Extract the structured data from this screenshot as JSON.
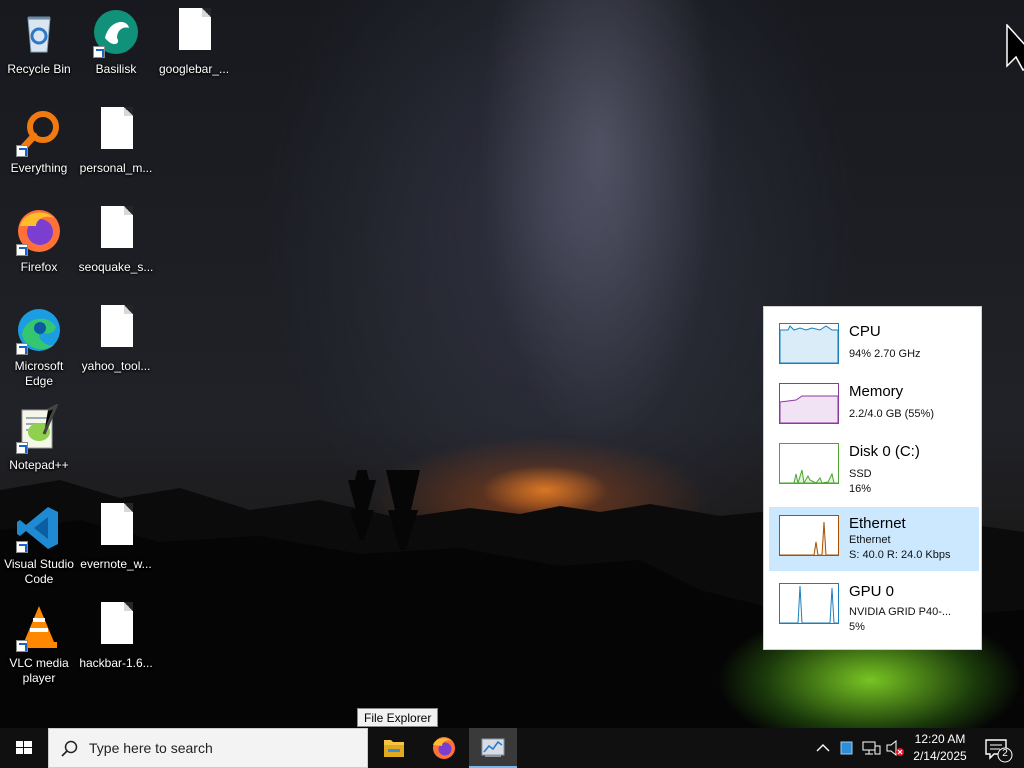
{
  "desktop": {
    "icons": [
      {
        "label": "Recycle Bin",
        "icon": "recycle-bin-icon"
      },
      {
        "label": "Basilisk",
        "icon": "basilisk-icon"
      },
      {
        "label": "googlebar_...",
        "icon": "file-icon"
      },
      {
        "label": "Everything",
        "icon": "everything-search-icon"
      },
      {
        "label": "personal_m...",
        "icon": "file-icon"
      },
      {
        "label": "Firefox",
        "icon": "firefox-icon"
      },
      {
        "label": "seoquake_s...",
        "icon": "file-icon"
      },
      {
        "label": "Microsoft Edge",
        "icon": "edge-icon"
      },
      {
        "label": "yahoo_tool...",
        "icon": "file-icon"
      },
      {
        "label": "Notepad++",
        "icon": "notepad-plus-plus-icon"
      },
      {
        "label": "Visual Studio Code",
        "icon": "vscode-icon"
      },
      {
        "label": "evernote_w...",
        "icon": "file-icon"
      },
      {
        "label": "VLC media player",
        "icon": "vlc-icon"
      },
      {
        "label": "hackbar-1.6...",
        "icon": "file-icon"
      }
    ]
  },
  "performance": {
    "items": [
      {
        "title": "CPU",
        "line1": "94%  2.70 GHz",
        "line2": "",
        "color": "#1c7fba"
      },
      {
        "title": "Memory",
        "line1": "2.2/4.0 GB (55%)",
        "line2": "",
        "color": "#8b3a9e"
      },
      {
        "title": "Disk 0 (C:)",
        "line1": "SSD",
        "line2": "16%",
        "color": "#4ca630"
      },
      {
        "title": "Ethernet",
        "line1": "Ethernet",
        "line2": "S: 40.0  R: 24.0 Kbps",
        "color": "#a74f01",
        "selected": true
      },
      {
        "title": "GPU 0",
        "line1": "NVIDIA GRID P40-...",
        "line2": "5%",
        "color": "#1c7fba"
      }
    ]
  },
  "taskbar": {
    "search_placeholder": "Type here to search",
    "tooltip": "File Explorer",
    "apps": [
      {
        "name": "File Explorer",
        "icon": "folder-icon"
      },
      {
        "name": "Firefox",
        "icon": "firefox-icon"
      },
      {
        "name": "Task Manager",
        "icon": "task-manager-icon",
        "active": true
      }
    ],
    "clock_time": "12:20 AM",
    "clock_date": "2/14/2025",
    "notification_count": "2"
  },
  "colors": {
    "accent": "#76b9ed",
    "taskbar": "#101010",
    "selection": "#cce8ff"
  }
}
